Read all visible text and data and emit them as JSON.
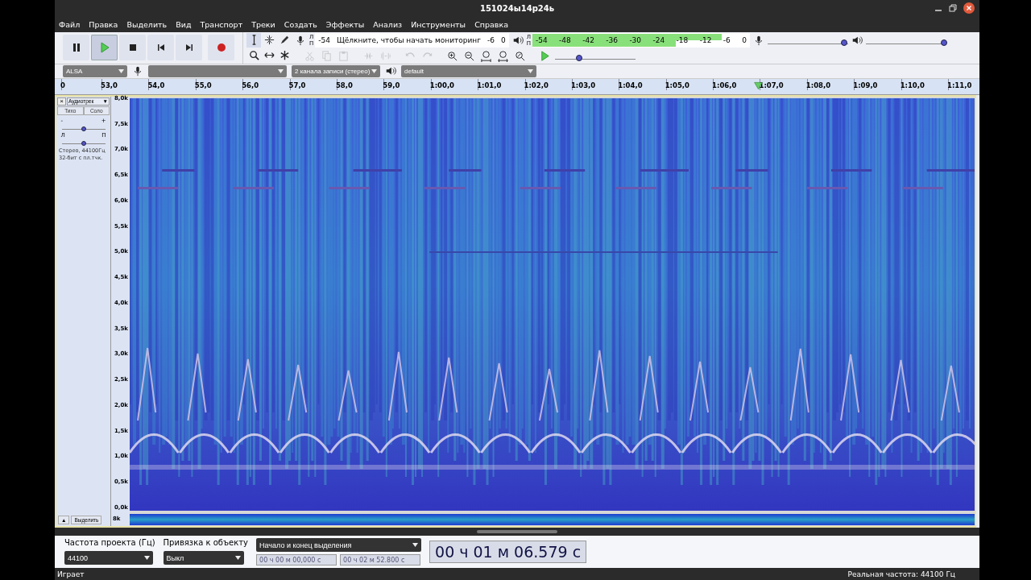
{
  "window": {
    "title": "151024ы14р24ь"
  },
  "menu": [
    "Файл",
    "Правка",
    "Выделить",
    "Вид",
    "Транспорт",
    "Треки",
    "Создать",
    "Эффекты",
    "Анализ",
    "Инструменты",
    "Справка"
  ],
  "transport": [
    {
      "kind": "pause",
      "pressed": false
    },
    {
      "kind": "play",
      "pressed": true
    },
    {
      "kind": "stop",
      "pressed": false
    },
    {
      "kind": "skip-start",
      "pressed": false
    },
    {
      "kind": "skip-end",
      "pressed": false
    },
    {
      "kind": "record",
      "pressed": false
    }
  ],
  "tools": [
    {
      "kind": "select",
      "selected": true
    },
    {
      "kind": "envelope",
      "selected": false
    },
    {
      "kind": "draw",
      "selected": false
    },
    {
      "kind": "zoom",
      "selected": false
    },
    {
      "kind": "timeshift",
      "selected": false
    },
    {
      "kind": "multi",
      "selected": false
    }
  ],
  "record_meter": {
    "channels": [
      "Л",
      "П"
    ],
    "ticks": [
      "-54",
      "-6",
      "0"
    ],
    "message": "Щёлкните, чтобы начать мониторинг"
  },
  "play_meter": {
    "channels": [
      {
        "label": "Л",
        "level": 0.87
      },
      {
        "label": "П",
        "level": 0.66
      }
    ],
    "ticks": [
      "-54",
      "-48",
      "-42",
      "-36",
      "-30",
      "-24",
      "-18",
      "-12",
      "-6",
      "0"
    ]
  },
  "mixer": {
    "record_volume": {
      "level": 0.95
    },
    "play_volume": {
      "level": 0.97
    }
  },
  "edit_tools": [
    {
      "kind": "cut",
      "disabled": true
    },
    {
      "kind": "copy",
      "disabled": true
    },
    {
      "kind": "paste",
      "disabled": true
    },
    {
      "kind": "trim",
      "disabled": true
    },
    {
      "kind": "silence",
      "disabled": true
    },
    {
      "kind": "undo",
      "disabled": true
    },
    {
      "kind": "redo",
      "disabled": true
    },
    {
      "kind": "zoom-in",
      "disabled": false
    },
    {
      "kind": "zoom-out",
      "disabled": false
    },
    {
      "kind": "fit-selection",
      "disabled": false
    },
    {
      "kind": "fit-project",
      "disabled": false
    },
    {
      "kind": "zoom-toggle",
      "disabled": false
    }
  ],
  "play_at_speed": {
    "level": 0.3
  },
  "devices": {
    "host": "ALSA",
    "channels": "2 канала записи (стерео)",
    "playback_device": "default"
  },
  "timeline": {
    "labels": [
      "0",
      "53,0",
      "54,0",
      "55,0",
      "56,0",
      "57,0",
      "58,0",
      "59,0",
      "1:00,0",
      "1:01,0",
      "1:02,0",
      "1:03,0",
      "1:04,0",
      "1:05,0",
      "1:06,0",
      "1:07,0",
      "1:08,0",
      "1:09,0",
      "1:10,0",
      "1:11,0"
    ]
  },
  "track": {
    "name": "Аудиотрек",
    "close": "×",
    "menu": "▼",
    "buttons": [
      {
        "label": "Тихо",
        "pressed": false
      },
      {
        "label": "Соло",
        "pressed": false
      }
    ],
    "gain": {
      "min": "-",
      "max": "+",
      "level": 0.5
    },
    "pan": {
      "min": "Л",
      "max": "П",
      "level": 0.5
    },
    "info": [
      "Стерео, 44100Гц",
      "32-бит с пл.тчк."
    ],
    "collapse": "▲",
    "select": "Выделить",
    "freq_labels": [
      "8,0k",
      "7,5k",
      "7,0k",
      "6,5k",
      "6,0k",
      "5,5k",
      "5,0k",
      "4,5k",
      "4,0k",
      "3,5k",
      "3,0k",
      "2,5k",
      "2,0k",
      "1,5k",
      "1,0k",
      "0,5k",
      "0,0k"
    ],
    "second_channel_label": "8k"
  },
  "selection_bar": {
    "rate_label": "Частота проекта (Гц)",
    "rate": "44100",
    "snap_label": "Привязка к объекту",
    "snap": "Выкл",
    "mode": "Начало и конец выделения",
    "start": "00 ч 00 м 00,000 с",
    "end": "00 ч 02 м 52.800 с",
    "position": "00 ч 01 м 06.579 с"
  },
  "status_bar": {
    "state": "Играет",
    "rate": "Реальная частота: 44100 Гц"
  }
}
